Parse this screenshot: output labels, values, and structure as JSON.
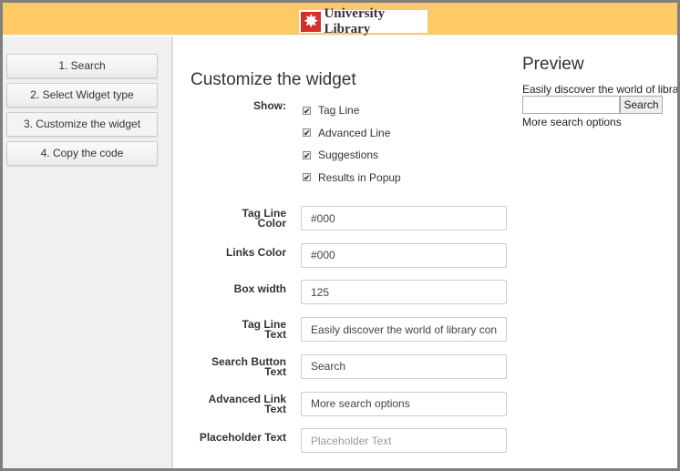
{
  "header": {
    "logo_text": "University Library",
    "logo_icon": "star-burst-icon",
    "color": "#ffc966"
  },
  "sidebar": {
    "steps": [
      {
        "label": "1. Search"
      },
      {
        "label": "2. Select Widget type"
      },
      {
        "label": "3. Customize the widget",
        "active": true
      },
      {
        "label": "4. Copy the code"
      }
    ]
  },
  "form": {
    "title": "Customize the widget",
    "show_label": "Show:",
    "checkboxes": [
      {
        "label": "Tag Line",
        "checked": true
      },
      {
        "label": "Advanced Line",
        "checked": true
      },
      {
        "label": "Suggestions",
        "checked": true
      },
      {
        "label": "Results in Popup",
        "checked": true
      }
    ],
    "fields": [
      {
        "label": "Tag Line Color",
        "value": "#000",
        "placeholder": ""
      },
      {
        "label": "Links Color",
        "value": "#000",
        "placeholder": ""
      },
      {
        "label": "Box width",
        "value": "125",
        "placeholder": ""
      },
      {
        "label": "Tag Line Text",
        "value": "Easily discover the world of library content",
        "placeholder": ""
      },
      {
        "label": "Search Button Text",
        "value": "Search",
        "placeholder": ""
      },
      {
        "label": "Advanced Link Text",
        "value": "More search options",
        "placeholder": ""
      },
      {
        "label": "Placeholder Text",
        "value": "",
        "placeholder": "Placeholder Text"
      }
    ]
  },
  "preview": {
    "title": "Preview",
    "tagline": "Easily discover the world of library",
    "search_button": "Search",
    "more_link": "More search options"
  }
}
